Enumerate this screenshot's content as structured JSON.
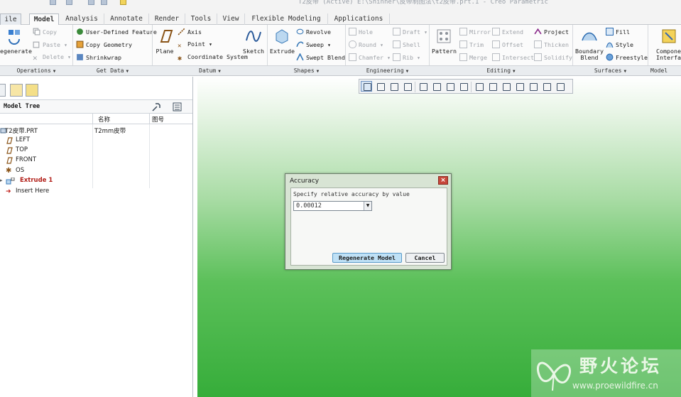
{
  "window": {
    "title": "T2皮带 (Active) E:\\Shinner\\皮带制图法\\t2皮带.prt.1 - Creo Parametric"
  },
  "ribbon": {
    "tabs": [
      {
        "label": "ile",
        "style": "file"
      },
      {
        "label": "Model",
        "style": "active"
      },
      {
        "label": "Analysis"
      },
      {
        "label": "Annotate"
      },
      {
        "label": "Render"
      },
      {
        "label": "Tools"
      },
      {
        "label": "View"
      },
      {
        "label": "Flexible Modeling"
      },
      {
        "label": "Applications"
      }
    ],
    "operations": {
      "regenerate": "egenerate",
      "copy": "Copy",
      "paste": "Paste",
      "delete": "Delete"
    },
    "get_data": {
      "udf": "User-Defined Feature",
      "copy_geometry": "Copy Geometry",
      "shrinkwrap": "Shrinkwrap"
    },
    "datum": {
      "plane": "Plane",
      "axis": "Axis",
      "point": "Point",
      "coord": "Coordinate System",
      "sketch": "Sketch"
    },
    "shapes": {
      "extrude": "Extrude",
      "revolve": "Revolve",
      "sweep": "Sweep",
      "swept_blend": "Swept Blend"
    },
    "engineering": {
      "hole": "Hole",
      "draft": "Draft",
      "round": "Round",
      "shell": "Shell",
      "chamfer": "Chamfer",
      "rib": "Rib"
    },
    "editing": {
      "pattern": "Pattern",
      "mirror": "Mirror",
      "extend": "Extend",
      "project": "Project",
      "trim": "Trim",
      "offset": "Offset",
      "thicken": "Thicken",
      "merge": "Merge",
      "intersect": "Intersect",
      "solidify": "Solidify"
    },
    "surfaces": {
      "boundary_blend_1": "Boundary",
      "boundary_blend_2": "Blend",
      "fill": "Fill",
      "style": "Style",
      "freestyle": "Freestyle"
    },
    "model_intent": {
      "component_1": "Compone",
      "component_2": "Interfa"
    },
    "groups": {
      "operations": "Operations",
      "get_data": "Get Data",
      "datum": "Datum",
      "shapes": "Shapes",
      "engineering": "Engineering",
      "editing": "Editing",
      "surfaces": "Surfaces",
      "model_intent": "Model Inte"
    },
    "group_arrow": "▼"
  },
  "tree": {
    "title": "Model Tree",
    "columns": {
      "name": "名称",
      "number": "图号"
    },
    "rows": [
      {
        "label": "T2皮带.PRT",
        "value": "T2mm皮带",
        "icon": "part-icon"
      },
      {
        "label": "LEFT",
        "icon": "datum-plane-icon"
      },
      {
        "label": "TOP",
        "icon": "datum-plane-icon"
      },
      {
        "label": "FRONT",
        "icon": "datum-plane-icon"
      },
      {
        "label": "OS",
        "icon": "coordinate-system-icon"
      },
      {
        "label": "Extrude 1",
        "icon": "extrude-feature-icon"
      },
      {
        "label": "Insert Here",
        "icon": "insert-arrow-icon"
      }
    ]
  },
  "dialog": {
    "title": "Accuracy",
    "close": "×",
    "prompt": "Specify relative accuracy by value",
    "value": "0.00012",
    "dropdown_arrow": "▼",
    "regenerate_button": "Regenerate Model",
    "cancel_button": "Cancel"
  },
  "watermark": {
    "name": "野火论坛",
    "url": "www.proewildfire.cn"
  },
  "colors": {
    "accent_blue": "#1d5fa8",
    "feature_red": "#b2201a",
    "viewport_green": "#36ad3a"
  }
}
